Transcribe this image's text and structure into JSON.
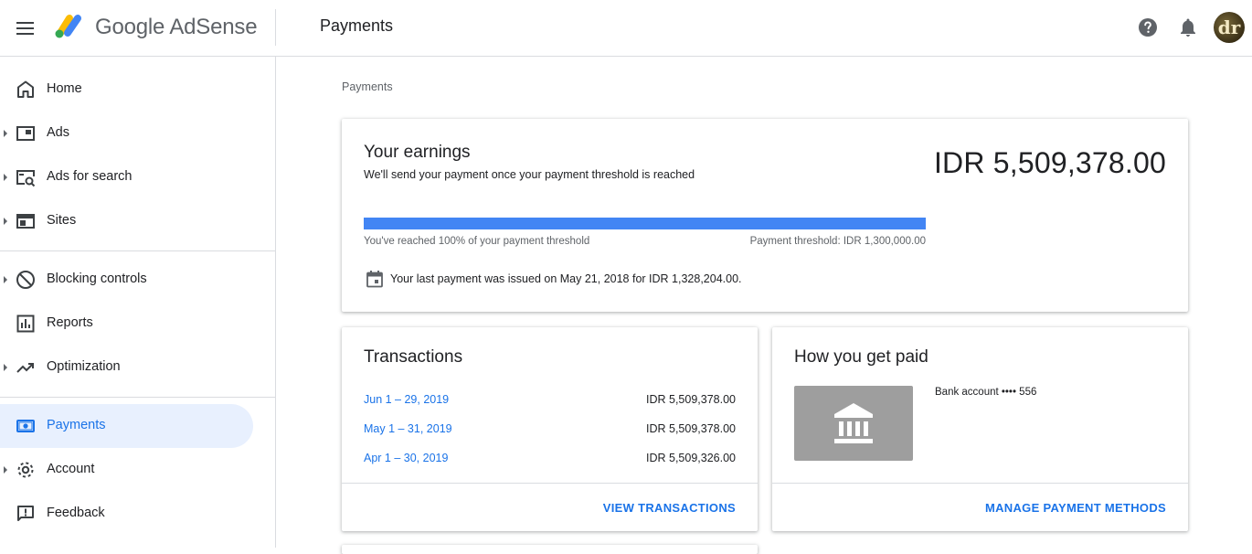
{
  "app": {
    "brand": "Google AdSense",
    "page_title": "Payments"
  },
  "header": {
    "title": "Payments",
    "avatar_initials": "dr"
  },
  "sidebar": {
    "items": [
      {
        "label": "Home",
        "icon": "home-icon",
        "has_caret": false
      },
      {
        "label": "Ads",
        "icon": "ads-icon",
        "has_caret": true
      },
      {
        "label": "Ads for search",
        "icon": "ads-for-search-icon",
        "has_caret": true
      },
      {
        "label": "Sites",
        "icon": "sites-icon",
        "has_caret": true
      },
      {
        "label": "Blocking controls",
        "icon": "block-icon",
        "has_caret": true
      },
      {
        "label": "Reports",
        "icon": "reports-icon",
        "has_caret": false
      },
      {
        "label": "Optimization",
        "icon": "trending-up-icon",
        "has_caret": true
      },
      {
        "label": "Payments",
        "icon": "payments-icon",
        "has_caret": false,
        "active": true
      },
      {
        "label": "Account",
        "icon": "gear-icon",
        "has_caret": true
      },
      {
        "label": "Feedback",
        "icon": "feedback-icon",
        "has_caret": false
      }
    ]
  },
  "breadcrumb": "Payments",
  "earnings": {
    "title": "Your earnings",
    "subtitle": "We'll send your payment once your payment threshold is reached",
    "amount": "IDR 5,509,378.00",
    "progress_percent": 100,
    "progress_left_text": "You've reached 100% of your payment threshold",
    "progress_right_text": "Payment threshold: IDR 1,300,000.00",
    "last_payment_text": "Your last payment was issued on May 21, 2018 for IDR 1,328,204.00."
  },
  "transactions": {
    "title": "Transactions",
    "rows": [
      {
        "date": "Jun 1 – 29, 2019",
        "amount": "IDR 5,509,378.00"
      },
      {
        "date": "May 1 – 31, 2019",
        "amount": "IDR 5,509,378.00"
      },
      {
        "date": "Apr 1 – 30, 2019",
        "amount": "IDR 5,509,326.00"
      }
    ],
    "action": "VIEW TRANSACTIONS"
  },
  "how_paid": {
    "title": "How you get paid",
    "bank_text": "Bank account •••• 556",
    "action": "MANAGE PAYMENT METHODS"
  },
  "colors": {
    "accent": "#1a73e8",
    "progress": "#4285f4",
    "active_bg": "#e8f0fe",
    "bank_box": "#9e9e9e"
  }
}
